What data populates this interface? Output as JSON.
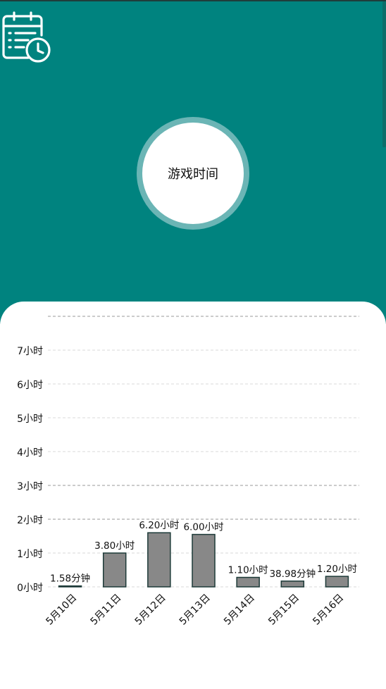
{
  "header": {
    "icon": "calendar-clock-icon",
    "button_label": "游戏时间",
    "color": "#00837f"
  },
  "chart_data": {
    "type": "bar",
    "categories": [
      "5月10日",
      "5月11日",
      "5月12日",
      "5月13日",
      "5月14日",
      "5月15日",
      "5月16日"
    ],
    "values": [
      0.0263,
      1.0,
      1.6,
      1.55,
      0.28,
      0.17,
      0.31
    ],
    "value_labels": [
      "1.58分钟",
      "3.80小时",
      "6.20小时",
      "6.00小时",
      "1.10小时",
      "38.98分钟",
      "1.20小时"
    ],
    "y_ticks": [
      "0小时",
      "1小时",
      "2小时",
      "3小时",
      "4小时",
      "5小时",
      "6小时",
      "7小时"
    ],
    "ylim": [
      0,
      8
    ],
    "bar_color": "#888888",
    "bar_stroke": "#1d3a38",
    "grid": true
  }
}
